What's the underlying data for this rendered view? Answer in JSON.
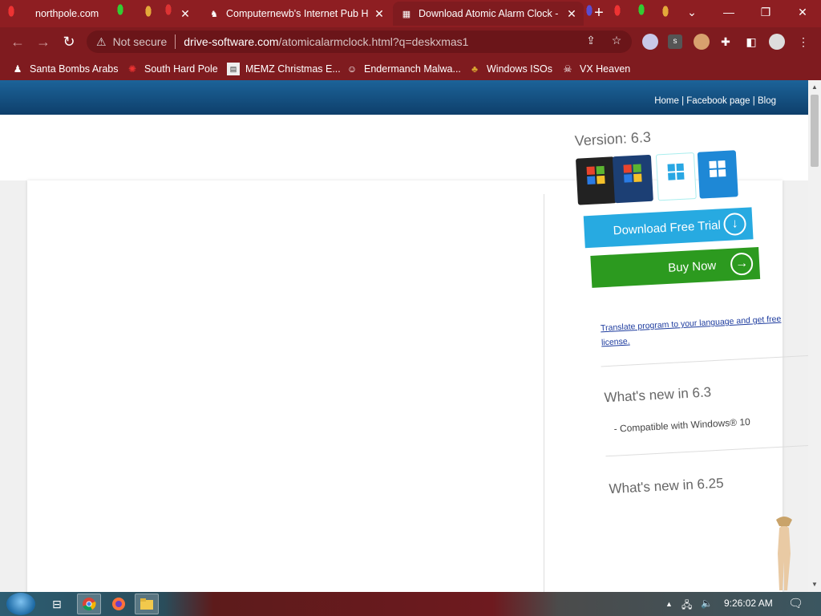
{
  "browser": {
    "tabs": [
      {
        "title": "northpole.com",
        "active": false
      },
      {
        "title": "Computernewb's Internet Pub H",
        "active": false
      },
      {
        "title": "Download Atomic Alarm Clock -",
        "active": true
      }
    ],
    "new_tab_label": "+",
    "window_controls": {
      "dropdown": "⌄",
      "minimize": "—",
      "restore": "❐",
      "close": "✕"
    },
    "address": {
      "security_label": "Not secure",
      "host": "drive-software.com",
      "path": "/atomicalarmclock.html?q=deskxmas1"
    },
    "bookmarks": [
      {
        "label": "Santa Bombs Arabs",
        "icon": "figure-icon"
      },
      {
        "label": "South Hard Pole",
        "icon": "virus-icon"
      },
      {
        "label": "MEMZ Christmas E...",
        "icon": "page-icon"
      },
      {
        "label": "Endermanch Malwa...",
        "icon": "raccoon-icon"
      },
      {
        "label": "Windows ISOs",
        "icon": "tree-icon"
      },
      {
        "label": "VX Heaven",
        "icon": "skull-icon"
      }
    ]
  },
  "site": {
    "top_links": {
      "home": "Home",
      "sep1": " | ",
      "facebook": "Facebook page",
      "sep2": " | ",
      "blog": "Blog"
    },
    "sidebar": {
      "version": "Version: 6.3",
      "badges": [
        {
          "name": "xp",
          "text": "Windows XP Compatible"
        },
        {
          "name": "w7",
          "text": "Compatible with Windows 7"
        },
        {
          "name": "w8",
          "text": "Windows 8 Compatible"
        },
        {
          "name": "w10",
          "text": "Windows 10 Compatible"
        }
      ],
      "download_button": "Download Free Trial",
      "buy_button": "Buy Now",
      "translate_link": "Translate program to your language and get free license.",
      "whats_new_1": "What's new in 6.3",
      "whats_new_1_item": "- Compatible with Windows® 10",
      "whats_new_2": "What's new in 6.25"
    }
  },
  "taskbar": {
    "clock": "9:26:02 AM"
  },
  "colors": {
    "theme_red": "#7f1b1f",
    "header_blue": "#0e3f6b",
    "download_blue": "#27aae1",
    "buy_green": "#2c9a1f",
    "link_blue": "#1f3d9f"
  }
}
